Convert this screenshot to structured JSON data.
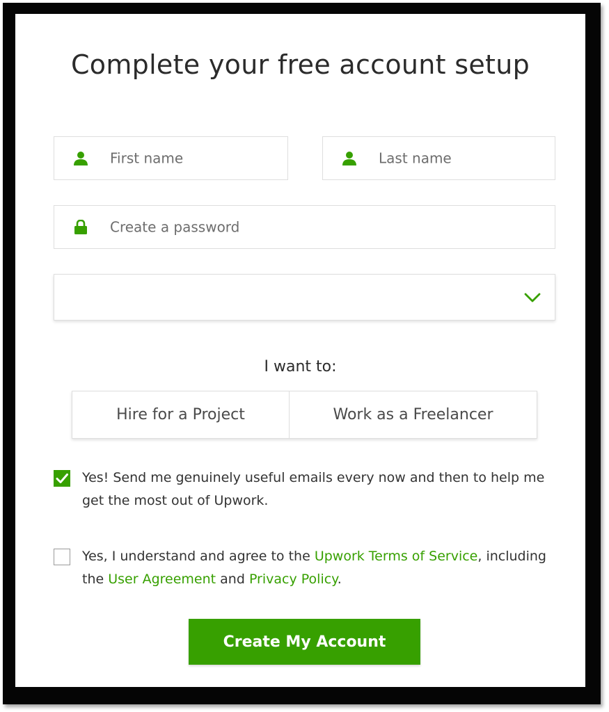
{
  "title": "Complete your free account setup",
  "fields": {
    "first_name_placeholder": "First name",
    "last_name_placeholder": "Last name",
    "password_placeholder": "Create a password",
    "country_value": ""
  },
  "intent": {
    "label": "I want to:",
    "options": [
      "Hire for a Project",
      "Work as a Freelancer"
    ]
  },
  "emails_opt_in": {
    "checked": true,
    "text": "Yes! Send me genuinely useful emails every now and then to help me get the most out of Upwork."
  },
  "terms": {
    "checked": false,
    "prefix": "Yes, I understand and agree to the ",
    "terms_link": "Upwork Terms of Service",
    "middle": ", including the ",
    "agreement_link": "User Agreement",
    "and": " and ",
    "privacy_link": "Privacy Policy",
    "suffix": "."
  },
  "submit_label": "Create My Account",
  "colors": {
    "accent": "#37a000",
    "frame": "#050505",
    "text": "#2b2b2b",
    "placeholder": "#6d6d6d",
    "border": "#dedede"
  },
  "icons": {
    "name": "user-icon",
    "password": "lock-icon",
    "dropdown": "chevron-down-icon",
    "checkbox": "checkmark-icon"
  }
}
